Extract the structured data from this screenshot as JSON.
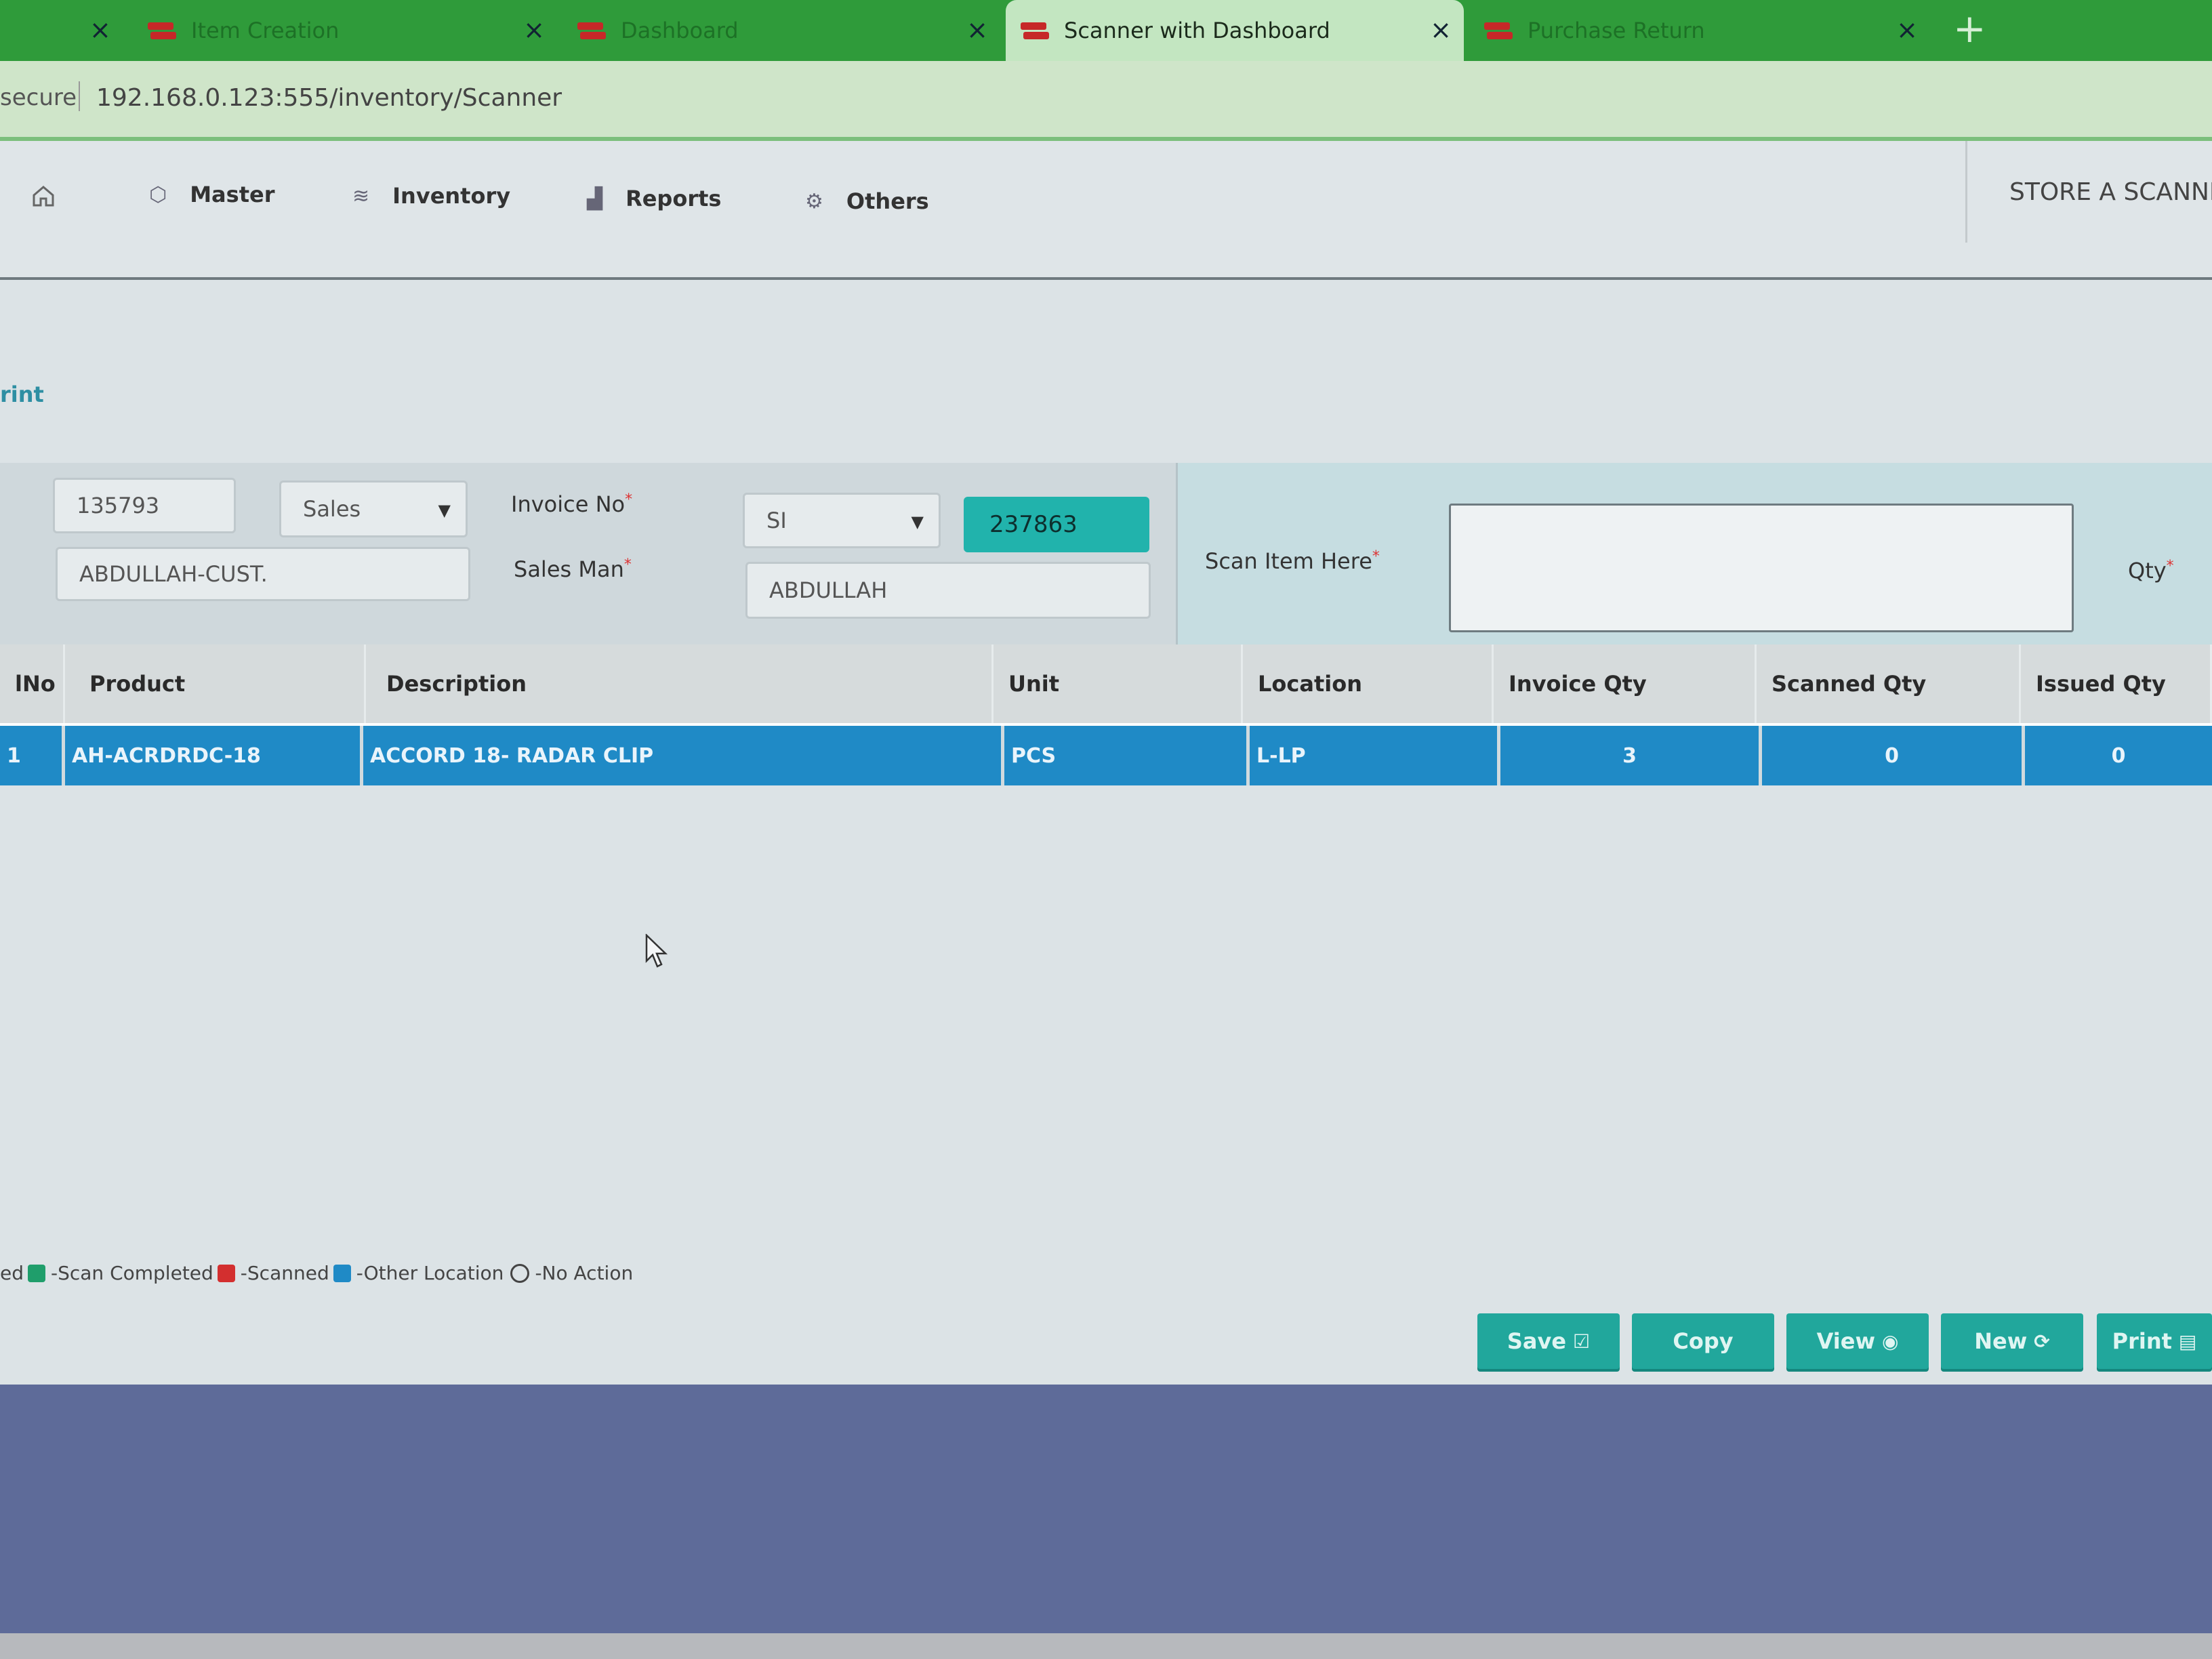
{
  "browser": {
    "tabs": [
      {
        "label": "Item Creation",
        "active": false
      },
      {
        "label": "Dashboard",
        "active": false
      },
      {
        "label": "Scanner with Dashboard",
        "active": true
      },
      {
        "label": "Purchase Return",
        "active": false
      }
    ],
    "tab_close": "×",
    "new_tab": "+",
    "secure_label": "secure",
    "url": "192.168.0.123:555/inventory/Scanner"
  },
  "nav": {
    "items": [
      {
        "label": "Master",
        "icon": "cube-icon"
      },
      {
        "label": "Inventory",
        "icon": "database-icon"
      },
      {
        "label": "Reports",
        "icon": "bar-chart-icon"
      },
      {
        "label": "Others",
        "icon": "settings-icon"
      }
    ],
    "home_icon": "home-icon",
    "store_title": "STORE A SCANNIN"
  },
  "breadcrumb": "rint",
  "form": {
    "doc_number": "135793",
    "type_select": "Sales",
    "customer": "ABDULLAH-CUST.",
    "invoice_no_label": "Invoice No",
    "invoice_prefix": "SI",
    "invoice_no_value": "237863",
    "sales_man_label": "Sales Man",
    "sales_man_value": "ABDULLAH",
    "scan_item_label": "Scan Item Here",
    "qty_label": "Qty",
    "required_mark": "*"
  },
  "grid": {
    "columns": [
      "lNo",
      "Product",
      "Description",
      "Unit",
      "Location",
      "Invoice Qty",
      "Scanned Qty",
      "Issued Qty"
    ],
    "rows": [
      {
        "no": "1",
        "product": "AH-ACRDRDC-18",
        "description": "ACCORD 18- RADAR CLIP",
        "unit": "PCS",
        "location": "L-LP",
        "invoice_qty": "3",
        "scanned_qty": "0",
        "issued_qty": "0"
      }
    ]
  },
  "legend": {
    "prefix": "ed",
    "items": [
      {
        "label": "-Scan Completed",
        "color": "#1f9e6b"
      },
      {
        "label": "-Scanned",
        "color": "#d32f2f"
      },
      {
        "label": "-Other Location",
        "color": "#1f8ac6"
      },
      {
        "label": "-No Action",
        "color": "none"
      }
    ]
  },
  "buttons": [
    {
      "label": "Save",
      "icon": "☑"
    },
    {
      "label": "Copy",
      "icon": ""
    },
    {
      "label": "View",
      "icon": "◉"
    },
    {
      "label": "New",
      "icon": "⟳"
    },
    {
      "label": "Print",
      "icon": "▤"
    }
  ],
  "colors": {
    "accent": "#21a79c",
    "row_highlight": "#1f8ac6",
    "invoice_badge": "#21b3ac",
    "browser_tabbar": "#2f9b3a"
  }
}
